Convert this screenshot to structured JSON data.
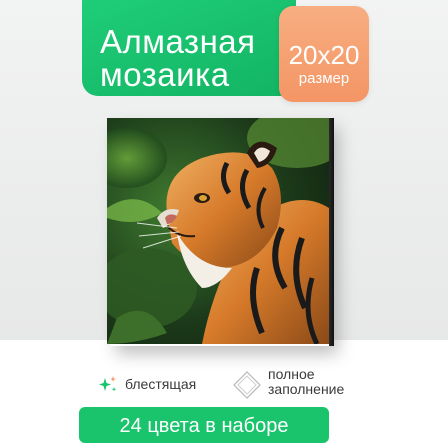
{
  "title": {
    "line1": "Алмазная",
    "line2": "мозаика"
  },
  "size_badge": {
    "value": "20x20",
    "label": "размер"
  },
  "features": [
    {
      "icon": "sparkle-icon",
      "label": "блестящая"
    },
    {
      "icon": "diamond-outline-icon",
      "label_line1": "полное",
      "label_line2": "заполнение"
    }
  ],
  "footer": {
    "text": "24 цвета в наборе"
  },
  "colors": {
    "green": "#1ac46c",
    "orange": "#f49565",
    "white": "#ffffff"
  },
  "artwork": {
    "subject": "tiger-image"
  }
}
